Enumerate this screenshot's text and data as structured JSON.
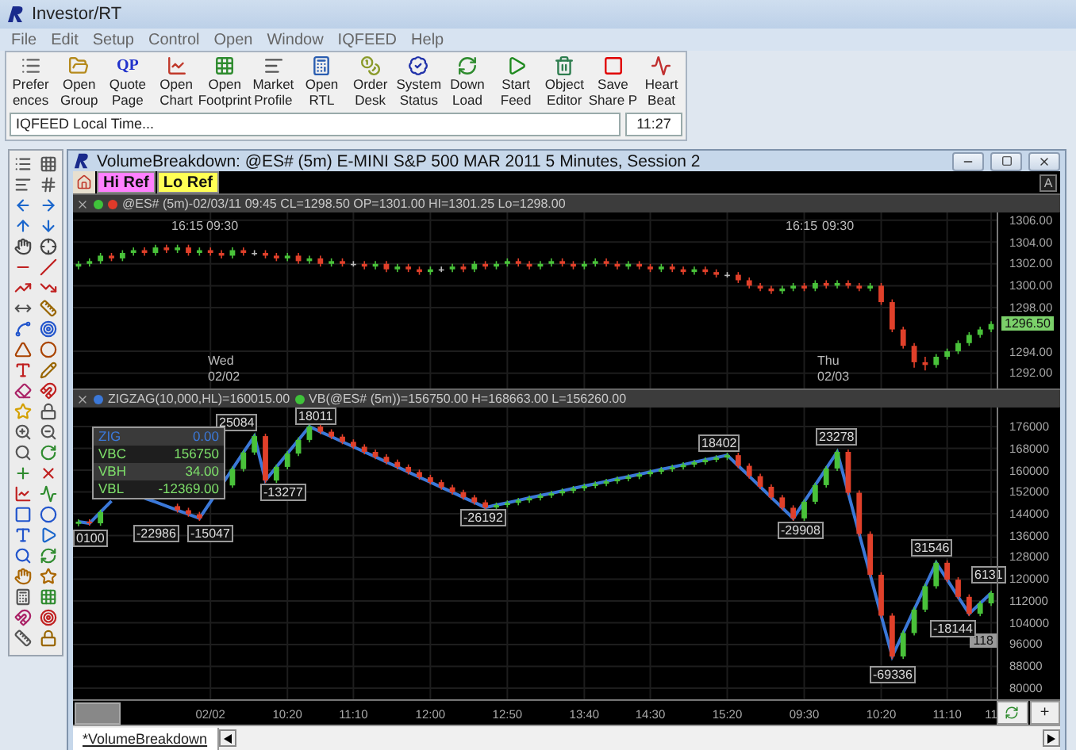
{
  "app": {
    "title": "Investor/RT"
  },
  "menu": [
    "File",
    "Edit",
    "Setup",
    "Control",
    "Open",
    "Window",
    "IQFEED",
    "Help"
  ],
  "toolbar": [
    {
      "lines": [
        "Prefer",
        "ences"
      ]
    },
    {
      "lines": [
        "Open",
        "Group"
      ]
    },
    {
      "lines": [
        "Quote",
        "Page"
      ],
      "icon_text": "QP"
    },
    {
      "lines": [
        "Open",
        "Chart"
      ]
    },
    {
      "lines": [
        "Open",
        "Footprint"
      ]
    },
    {
      "lines": [
        "Market",
        "Profile"
      ]
    },
    {
      "lines": [
        "Open",
        "RTL"
      ]
    },
    {
      "lines": [
        "Order",
        "Desk"
      ]
    },
    {
      "lines": [
        "System",
        "Status"
      ]
    },
    {
      "lines": [
        "Down",
        "Load"
      ]
    },
    {
      "lines": [
        "Start",
        "Feed"
      ]
    },
    {
      "lines": [
        "Object",
        "Editor"
      ]
    },
    {
      "lines": [
        "Save",
        "Share P"
      ]
    },
    {
      "lines": [
        "Heart",
        "Beat"
      ]
    }
  ],
  "status": {
    "message": "IQFEED Local Time...",
    "time": "11:27"
  },
  "chart_window": {
    "title": "VolumeBreakdown: @ES# (5m) E-MINI S&P 500 MAR 2011 5 Minutes, Session 2",
    "ref_buttons": [
      {
        "label": "Hi Ref",
        "color": "#ff80ff"
      },
      {
        "label": "Lo Ref",
        "color": "#ffff55"
      }
    ],
    "scale_button": "A",
    "price_panel": {
      "header": "@ES# (5m)-02/03/11 09:45 CL=1298.50 OP=1301.00 HI=1301.25 Lo=1298.00",
      "current_price": "1296.50",
      "session_labels": [
        {
          "close": "16:15",
          "open": "09:30"
        },
        {
          "close": "16:15",
          "open": "09:30"
        }
      ],
      "day_labels": [
        {
          "day": "Wed",
          "date": "02/02"
        },
        {
          "day": "Thu",
          "date": "02/03"
        }
      ],
      "chart_data": {
        "type": "candlestick",
        "grid": true,
        "ylim": [
          1290.6,
          1306.7
        ],
        "yticks": [
          {
            "value": 1306,
            "label": "1306.00"
          },
          {
            "value": 1304,
            "label": "1304.00"
          },
          {
            "value": 1302,
            "label": "1302.00"
          },
          {
            "value": 1300,
            "label": "1300.00"
          },
          {
            "value": 1298,
            "label": "1298.00"
          },
          {
            "value": 1294,
            "label": "1294.00"
          },
          {
            "value": 1292,
            "label": "1292.00"
          }
        ],
        "categories": [
          null,
          null,
          null,
          null,
          null,
          null,
          null,
          null,
          null,
          null,
          null,
          null,
          null,
          null,
          null,
          null,
          null,
          null,
          null,
          null,
          null,
          null,
          null,
          null,
          null,
          null,
          null,
          null,
          null,
          null,
          null,
          null,
          null,
          null,
          null,
          null,
          null,
          null,
          null,
          null,
          null,
          null,
          null,
          null,
          null,
          null,
          null,
          null,
          null,
          null,
          null,
          null,
          null,
          null,
          null,
          null,
          null,
          null,
          null,
          null,
          null,
          null,
          null,
          null,
          null,
          null,
          null,
          null,
          null,
          null,
          null,
          null,
          null,
          null,
          null,
          null,
          null,
          null,
          null,
          null,
          null,
          null,
          null,
          null
        ],
        "ohlc": [
          [
            1301.75,
            1302.25,
            1301.5,
            1302
          ],
          [
            1302,
            1302.5,
            1301.75,
            1302.25
          ],
          [
            1302.25,
            1303,
            1302,
            1302.75
          ],
          [
            1302.75,
            1303,
            1302.25,
            1302.5
          ],
          [
            1302.5,
            1303.25,
            1302.25,
            1303
          ],
          [
            1303,
            1303.5,
            1302.75,
            1303.25
          ],
          [
            1303.25,
            1303.5,
            1302.75,
            1303
          ],
          [
            1303,
            1303.75,
            1302.75,
            1303.5
          ],
          [
            1303.5,
            1303.75,
            1303,
            1303.25
          ],
          [
            1303.25,
            1303.75,
            1303,
            1303.5
          ],
          [
            1303.5,
            1303.75,
            1302.75,
            1303
          ],
          [
            1303,
            1303.5,
            1302.75,
            1303.25
          ],
          [
            1303.25,
            1303.5,
            1302.75,
            1303
          ],
          [
            1303,
            1303.25,
            1302.5,
            1302.75
          ],
          [
            1302.75,
            1303.5,
            1302.5,
            1303.25
          ],
          [
            1303.25,
            1303.5,
            1302.75,
            1303
          ],
          [
            1303,
            1303.25,
            1302.75,
            1303
          ],
          [
            1303,
            1303.25,
            1302.5,
            1302.75
          ],
          [
            1302.75,
            1303,
            1302.25,
            1302.5
          ],
          [
            1302.5,
            1303,
            1302.25,
            1302.75
          ],
          [
            1302.75,
            1303,
            1302,
            1302.25
          ],
          [
            1302.25,
            1302.75,
            1302,
            1302.5
          ],
          [
            1302.5,
            1302.75,
            1301.75,
            1302
          ],
          [
            1302,
            1302.5,
            1301.75,
            1302.25
          ],
          [
            1302.25,
            1302.5,
            1301.75,
            1302
          ],
          [
            1302,
            1302.25,
            1301.75,
            1302
          ],
          [
            1302,
            1302.25,
            1301.5,
            1301.75
          ],
          [
            1301.75,
            1302.25,
            1301.5,
            1302
          ],
          [
            1302,
            1302.25,
            1301.25,
            1301.5
          ],
          [
            1301.5,
            1302,
            1301.25,
            1301.75
          ],
          [
            1301.75,
            1302,
            1301.25,
            1301.5
          ],
          [
            1301.5,
            1301.75,
            1301,
            1301.25
          ],
          [
            1301.25,
            1301.75,
            1301,
            1301.5
          ],
          [
            1301.5,
            1301.75,
            1301.25,
            1301.5
          ],
          [
            1301.5,
            1302,
            1301.25,
            1301.75
          ],
          [
            1301.75,
            1302,
            1301.25,
            1301.5
          ],
          [
            1301.5,
            1302.25,
            1301.25,
            1302
          ],
          [
            1302,
            1302.25,
            1301.5,
            1301.75
          ],
          [
            1301.75,
            1302.25,
            1301.5,
            1302
          ],
          [
            1302,
            1302.5,
            1301.75,
            1302.25
          ],
          [
            1302.25,
            1302.5,
            1301.75,
            1302
          ],
          [
            1302,
            1302.25,
            1301.5,
            1301.75
          ],
          [
            1301.75,
            1302.25,
            1301.5,
            1302
          ],
          [
            1302,
            1302.5,
            1301.75,
            1302.25
          ],
          [
            1302.25,
            1302.5,
            1301.75,
            1302
          ],
          [
            1302,
            1302.25,
            1301.5,
            1301.75
          ],
          [
            1301.75,
            1302.25,
            1301.5,
            1302
          ],
          [
            1302,
            1302.5,
            1301.75,
            1302.25
          ],
          [
            1302.25,
            1302.5,
            1301.75,
            1302
          ],
          [
            1302,
            1302.25,
            1301.5,
            1301.75
          ],
          [
            1301.75,
            1302.25,
            1301.5,
            1302
          ],
          [
            1302,
            1302.25,
            1301.5,
            1301.75
          ],
          [
            1301.75,
            1302,
            1301.25,
            1301.5
          ],
          [
            1301.5,
            1302,
            1301.25,
            1301.75
          ],
          [
            1301.75,
            1302,
            1301.25,
            1301.5
          ],
          [
            1301.5,
            1301.75,
            1301,
            1301.25
          ],
          [
            1301.25,
            1301.75,
            1301,
            1301.5
          ],
          [
            1301.5,
            1301.75,
            1301,
            1301.25
          ],
          [
            1301.25,
            1301.5,
            1300.75,
            1301
          ],
          [
            1301,
            1301.25,
            1300.75,
            1301
          ],
          [
            1301,
            1301.25,
            1300.25,
            1300.5
          ],
          [
            1300.5,
            1300.75,
            1299.75,
            1300
          ],
          [
            1300,
            1300.25,
            1299.5,
            1299.75
          ],
          [
            1299.75,
            1300,
            1299.25,
            1299.5
          ],
          [
            1299.5,
            1300,
            1299.25,
            1299.75
          ],
          [
            1299.75,
            1300.25,
            1299.5,
            1300
          ],
          [
            1300,
            1300.25,
            1299.5,
            1299.75
          ],
          [
            1299.75,
            1300.5,
            1299.5,
            1300.25
          ],
          [
            1300.25,
            1300.5,
            1299.75,
            1300
          ],
          [
            1300,
            1300.5,
            1299.75,
            1300.25
          ],
          [
            1300.25,
            1300.5,
            1299.75,
            1300
          ],
          [
            1300,
            1300.25,
            1299.5,
            1299.75
          ],
          [
            1299.75,
            1300.25,
            1299.5,
            1300
          ],
          [
            1300,
            1300.25,
            1298.25,
            1298.5
          ],
          [
            1298.5,
            1298.75,
            1295.75,
            1296
          ],
          [
            1296,
            1296.25,
            1294.25,
            1294.5
          ],
          [
            1294.5,
            1294.75,
            1292.5,
            1293
          ],
          [
            1293,
            1293.5,
            1292.25,
            1292.75
          ],
          [
            1292.75,
            1293.75,
            1292.5,
            1293.5
          ],
          [
            1293.5,
            1294.25,
            1293.25,
            1294
          ],
          [
            1294,
            1295,
            1293.75,
            1294.75
          ],
          [
            1294.75,
            1295.75,
            1294.5,
            1295.5
          ],
          [
            1295.5,
            1296.25,
            1295.25,
            1296
          ],
          [
            1296,
            1296.75,
            1295.75,
            1296.5
          ]
        ]
      }
    },
    "volume_panel": {
      "header_zigzag": "ZIGZAG(10,000,HL)=160015.00",
      "header_vb": "VB(@ES# (5m))=156750.00 H=168663.00 L=156260.00",
      "legend": [
        {
          "name": "ZIG",
          "value": "0.00",
          "color": "#3b78d8"
        },
        {
          "name": "VBC",
          "value": "156750",
          "color": "#7ee06a"
        },
        {
          "name": "VBH",
          "value": "34.00",
          "color": "#7ee06a"
        },
        {
          "name": "VBL",
          "value": "-12369.00",
          "color": "#7ee06a"
        }
      ],
      "current_value": "118",
      "zigzag_labels": [
        "0100",
        "-22986",
        "-15047",
        "25084",
        "-13277",
        "18011",
        "-26192",
        "18402",
        "-29908",
        "23278",
        "-69336",
        "31546",
        "-18144",
        "6131"
      ],
      "chart_data": {
        "type": "candlestick",
        "grid": true,
        "ylim": [
          75900,
          183000
        ],
        "yticks": [
          176000,
          168000,
          160000,
          152000,
          144000,
          136000,
          128000,
          120000,
          112000,
          104000,
          96000,
          88000,
          80000
        ],
        "categories": [
          null,
          null,
          null,
          null,
          null,
          null,
          null,
          null,
          null,
          null,
          null,
          null,
          "02/02",
          null,
          null,
          null,
          null,
          null,
          null,
          "10:20",
          null,
          null,
          null,
          null,
          null,
          "11:10",
          null,
          null,
          null,
          null,
          null,
          null,
          "12:00",
          null,
          null,
          null,
          null,
          null,
          null,
          "12:50",
          null,
          null,
          null,
          null,
          null,
          null,
          "13:40",
          null,
          null,
          null,
          null,
          null,
          "14:30",
          null,
          null,
          null,
          null,
          null,
          null,
          "15:20",
          null,
          null,
          null,
          null,
          null,
          null,
          "09:30",
          null,
          null,
          null,
          null,
          null,
          null,
          "10:20",
          null,
          null,
          null,
          null,
          null,
          "11:10",
          null,
          null,
          null,
          "11"
        ],
        "ohlc": [
          [
            140300,
            142000,
            139400,
            141100
          ],
          [
            141100,
            142000,
            139600,
            140500
          ],
          [
            140500,
            145500,
            139600,
            144600
          ],
          null,
          null,
          null,
          null,
          null,
          null,
          [
            146800,
            147700,
            144400,
            145300
          ],
          [
            145300,
            146200,
            142900,
            143800
          ],
          [
            143800,
            144700,
            141400,
            142300
          ],
          null,
          null,
          [
            154400,
            161300,
            153500,
            160400
          ],
          [
            160400,
            167400,
            159500,
            166500
          ],
          [
            166500,
            173400,
            165600,
            172500
          ],
          [
            172500,
            173400,
            155300,
            156200
          ],
          [
            156200,
            162100,
            155300,
            161200
          ],
          [
            161200,
            167000,
            160300,
            166100
          ],
          [
            166100,
            172000,
            165200,
            171100
          ],
          [
            171100,
            176900,
            170200,
            176000
          ],
          [
            176000,
            176900,
            173200,
            174100
          ],
          [
            174100,
            175000,
            171400,
            172300
          ],
          [
            172300,
            173200,
            169500,
            170400
          ],
          [
            170400,
            171300,
            167700,
            168600
          ],
          [
            168600,
            169500,
            165800,
            166700
          ],
          [
            166700,
            167600,
            164000,
            164900
          ],
          [
            164900,
            165800,
            162100,
            163000
          ],
          [
            163000,
            163900,
            160300,
            161200
          ],
          [
            161200,
            162100,
            158400,
            159300
          ],
          [
            159300,
            160200,
            156500,
            157400
          ],
          [
            157400,
            158300,
            154700,
            155600
          ],
          [
            155600,
            156500,
            152800,
            153700
          ],
          [
            153700,
            154600,
            151000,
            151900
          ],
          [
            151900,
            152800,
            149100,
            150000
          ],
          [
            150000,
            150900,
            147300,
            148200
          ],
          [
            148200,
            149100,
            145400,
            146300
          ],
          [
            146300,
            148100,
            145400,
            147200
          ],
          [
            147200,
            148900,
            146300,
            148000
          ],
          [
            148000,
            149800,
            147100,
            148900
          ],
          [
            148900,
            150700,
            148000,
            149800
          ],
          [
            149800,
            151600,
            148900,
            150700
          ],
          [
            150700,
            152400,
            149800,
            151500
          ],
          [
            151500,
            153300,
            150600,
            152400
          ],
          [
            152400,
            154200,
            151500,
            153300
          ],
          [
            153300,
            155100,
            152400,
            154200
          ],
          [
            154200,
            155900,
            153300,
            155000
          ],
          [
            155000,
            156800,
            154100,
            155900
          ],
          [
            155900,
            157700,
            155000,
            156800
          ],
          [
            156800,
            158500,
            155900,
            157600
          ],
          [
            157600,
            159400,
            156700,
            158500
          ],
          [
            158500,
            160300,
            157600,
            159400
          ],
          [
            159400,
            161200,
            158500,
            160300
          ],
          [
            160300,
            162000,
            159400,
            161100
          ],
          [
            161100,
            162900,
            160200,
            162000
          ],
          [
            162000,
            163800,
            161100,
            162900
          ],
          [
            162900,
            164700,
            162000,
            163800
          ],
          [
            163800,
            165500,
            162900,
            164600
          ],
          [
            164600,
            166400,
            163700,
            165500
          ],
          [
            165500,
            166400,
            160700,
            161600
          ],
          [
            161600,
            162500,
            156900,
            157800
          ],
          [
            157800,
            158700,
            153000,
            153900
          ],
          [
            153900,
            154800,
            149100,
            150000
          ],
          [
            150000,
            150900,
            145300,
            146200
          ],
          [
            146200,
            147100,
            141400,
            142300
          ],
          [
            142300,
            149300,
            141400,
            148400
          ],
          [
            148400,
            155400,
            147500,
            154500
          ],
          [
            154500,
            161500,
            153600,
            160600
          ],
          [
            160600,
            167600,
            159700,
            166700
          ],
          [
            166700,
            167600,
            150800,
            151700
          ],
          [
            151700,
            152600,
            135700,
            136600
          ],
          [
            136600,
            137500,
            120700,
            121600
          ],
          [
            121600,
            122500,
            105700,
            106600
          ],
          [
            106600,
            107500,
            90700,
            91600
          ],
          [
            91600,
            101100,
            90700,
            100200
          ],
          [
            100200,
            109700,
            99300,
            108800
          ],
          [
            108800,
            118300,
            107900,
            117400
          ],
          [
            117400,
            126900,
            116500,
            126000
          ],
          [
            126000,
            126900,
            118900,
            119800
          ],
          [
            119800,
            120700,
            112600,
            113500
          ],
          [
            113500,
            114400,
            106400,
            107300
          ],
          [
            107300,
            112000,
            106400,
            111100
          ],
          [
            111100,
            115800,
            110200,
            114900
          ]
        ],
        "series": [
          {
            "type": "line",
            "color": "#3b78d8",
            "values": [
              141100,
              140500,
              144600,
              148700,
              null,
              null,
              149700,
              148300,
              146800,
              145300,
              143800,
              142300,
              148300,
              154400,
              160400,
              166500,
              172500,
              156200,
              161200,
              166100,
              171100,
              176000,
              174100,
              172300,
              170400,
              168600,
              166700,
              164900,
              163000,
              161200,
              159300,
              157400,
              155600,
              153700,
              151900,
              150000,
              148200,
              146300,
              147200,
              148000,
              148900,
              149800,
              150700,
              151500,
              152400,
              153300,
              154200,
              155000,
              155900,
              156800,
              157600,
              158500,
              159400,
              160300,
              161100,
              162000,
              162900,
              163800,
              164600,
              165500,
              161600,
              157800,
              153900,
              150000,
              146200,
              142300,
              148400,
              154500,
              160600,
              166700,
              151700,
              136600,
              121600,
              106600,
              91600,
              100200,
              108800,
              117400,
              126000,
              119800,
              113500,
              107300,
              111100,
              114900
            ]
          }
        ]
      }
    },
    "zoom_button": "+",
    "tabs": [
      {
        "label": "*VolumeBreakdown",
        "selected": true
      }
    ]
  }
}
